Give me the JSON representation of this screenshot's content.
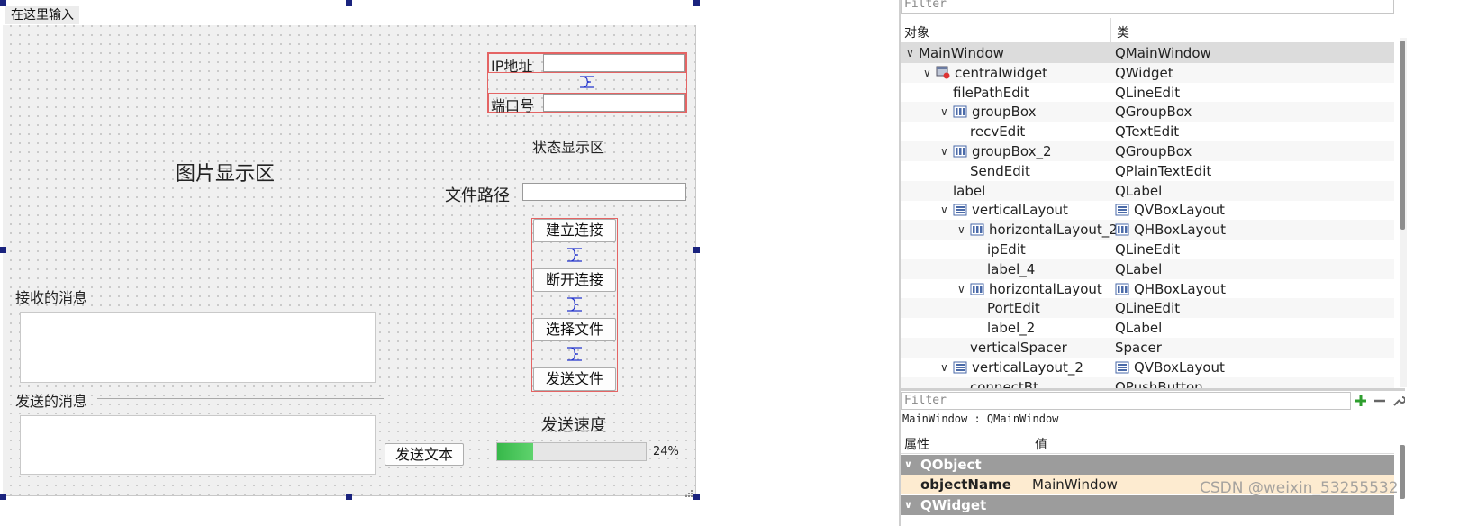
{
  "form": {
    "menubar_entry": "在这里输入",
    "image_area_label": "图片显示区",
    "ip_label": "IP地址",
    "port_label": "端口号",
    "status_label": "状态显示区",
    "filepath_label": "文件路径",
    "buttons": {
      "connect": "建立连接",
      "disconnect": "断开连接",
      "choose_file": "选择文件",
      "send_file": "发送文件",
      "send_text": "发送文本"
    },
    "recv_group_title": "接收的消息",
    "send_group_title": "发送的消息",
    "speed_label": "发送速度",
    "progress": {
      "value": 24,
      "text": "24%",
      "fill_color": "#3cbf4e"
    },
    "selection_handle_color": "#1a237e",
    "layout_border_color": "#e46464"
  },
  "object_inspector": {
    "filter_placeholder": "Filter",
    "columns": {
      "object": "对象",
      "class": "类"
    },
    "rows": [
      {
        "name": "MainWindow",
        "cls": "QMainWindow",
        "depth": 0,
        "expand": "v",
        "icon": "",
        "cls_icon": ""
      },
      {
        "name": "centralwidget",
        "cls": "QWidget",
        "depth": 1,
        "expand": "v",
        "icon": "widget-icon",
        "cls_icon": ""
      },
      {
        "name": "filePathEdit",
        "cls": "QLineEdit",
        "depth": 2,
        "expand": "",
        "icon": "",
        "cls_icon": ""
      },
      {
        "name": "groupBox",
        "cls": "QGroupBox",
        "depth": 2,
        "expand": "v",
        "icon": "hlayout-icon",
        "cls_icon": ""
      },
      {
        "name": "recvEdit",
        "cls": "QTextEdit",
        "depth": 3,
        "expand": "",
        "icon": "",
        "cls_icon": ""
      },
      {
        "name": "groupBox_2",
        "cls": "QGroupBox",
        "depth": 2,
        "expand": "v",
        "icon": "hlayout-icon",
        "cls_icon": ""
      },
      {
        "name": "SendEdit",
        "cls": "QPlainTextEdit",
        "depth": 3,
        "expand": "",
        "icon": "",
        "cls_icon": ""
      },
      {
        "name": "label",
        "cls": "QLabel",
        "depth": 2,
        "expand": "",
        "icon": "",
        "cls_icon": ""
      },
      {
        "name": "verticalLayout",
        "cls": "QVBoxLayout",
        "depth": 2,
        "expand": "v",
        "icon": "vlayout-icon",
        "cls_icon": "vlayout-icon"
      },
      {
        "name": "horizontalLayout_2",
        "cls": "QHBoxLayout",
        "depth": 3,
        "expand": "v",
        "icon": "hlayout-icon",
        "cls_icon": "hlayout-icon"
      },
      {
        "name": "ipEdit",
        "cls": "QLineEdit",
        "depth": 4,
        "expand": "",
        "icon": "",
        "cls_icon": ""
      },
      {
        "name": "label_4",
        "cls": "QLabel",
        "depth": 4,
        "expand": "",
        "icon": "",
        "cls_icon": ""
      },
      {
        "name": "horizontalLayout",
        "cls": "QHBoxLayout",
        "depth": 3,
        "expand": "v",
        "icon": "hlayout-icon",
        "cls_icon": "hlayout-icon"
      },
      {
        "name": "PortEdit",
        "cls": "QLineEdit",
        "depth": 4,
        "expand": "",
        "icon": "",
        "cls_icon": ""
      },
      {
        "name": "label_2",
        "cls": "QLabel",
        "depth": 4,
        "expand": "",
        "icon": "",
        "cls_icon": ""
      },
      {
        "name": "verticalSpacer",
        "cls": "Spacer",
        "depth": 3,
        "expand": "",
        "icon": "",
        "cls_icon": ""
      },
      {
        "name": "verticalLayout_2",
        "cls": "QVBoxLayout",
        "depth": 2,
        "expand": "v",
        "icon": "vlayout-icon",
        "cls_icon": "vlayout-icon"
      },
      {
        "name": "connectBt",
        "cls": "QPushButton",
        "depth": 3,
        "expand": "",
        "icon": "",
        "cls_icon": ""
      }
    ]
  },
  "property_editor": {
    "filter_placeholder": "Filter",
    "object_line": "MainWindow : QMainWindow",
    "columns": {
      "property": "属性",
      "value": "值"
    },
    "group_qobject": "QObject",
    "objectname_key": "objectName",
    "objectname_value": "MainWindow",
    "group_qwidget": "QWidget"
  },
  "watermark": "CSDN @weixin_53255532"
}
